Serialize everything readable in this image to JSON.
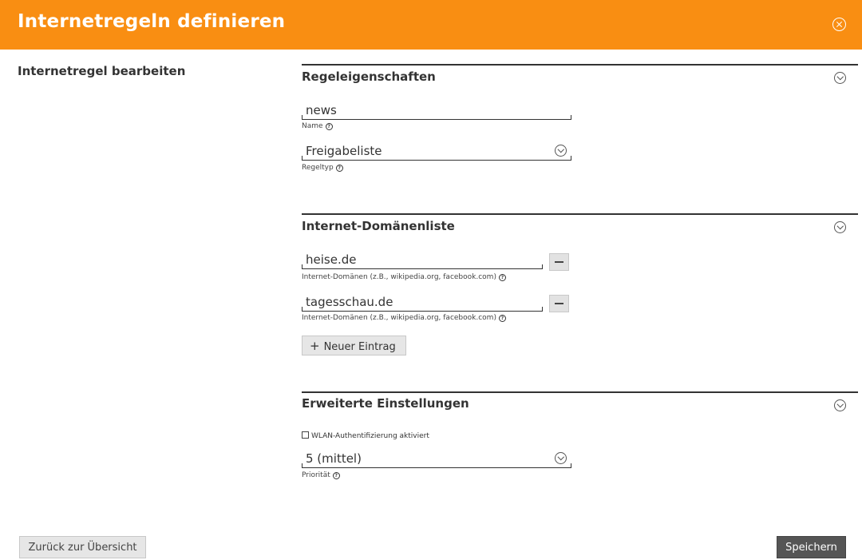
{
  "header": {
    "title": "Internetregeln definieren",
    "close_icon": "close-circle-icon"
  },
  "left": {
    "title": "Internetregel bearbeiten"
  },
  "sections": {
    "properties": {
      "title": "Regeleigenschaften",
      "name_value": "news",
      "name_label": "Name",
      "type_value": "Freigabeliste",
      "type_label": "Regeltyp"
    },
    "domains": {
      "title": "Internet-Domänenliste",
      "entries": [
        {
          "value": "heise.de",
          "label": "Internet-Domänen (z.B., wikipedia.org, facebook.com)"
        },
        {
          "value": "tagesschau.de",
          "label": "Internet-Domänen (z.B., wikipedia.org, facebook.com)"
        }
      ],
      "add_label": "Neuer Eintrag"
    },
    "advanced": {
      "title": "Erweiterte Einstellungen",
      "wlan_label": "WLAN-Authentifizierung aktiviert",
      "wlan_checked": false,
      "priority_value": "5 (mittel)",
      "priority_label": "Priorität"
    }
  },
  "footer": {
    "back_label": "Zurück zur Übersicht",
    "save_label": "Speichern"
  },
  "help_glyph": "?",
  "colors": {
    "header_bg": "#f98e12",
    "save_bg": "#555555"
  }
}
